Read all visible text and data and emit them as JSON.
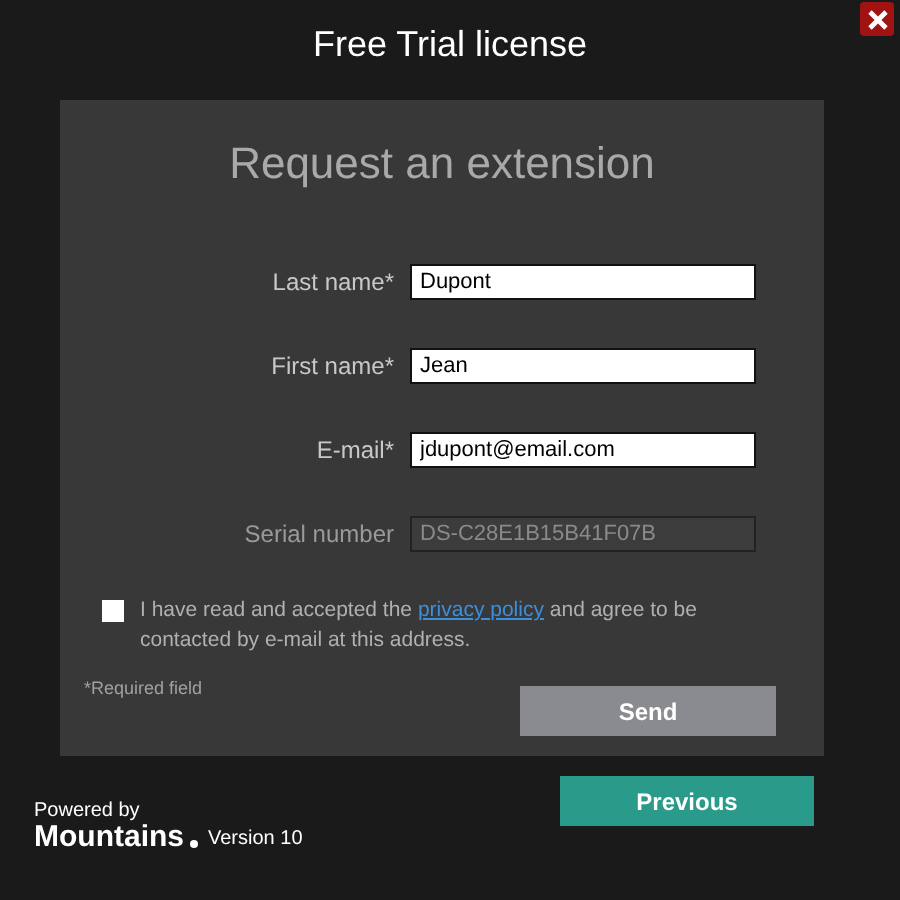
{
  "window": {
    "title": "Free Trial license"
  },
  "form": {
    "heading": "Request an extension",
    "fields": [
      {
        "label": "Last name*",
        "value": "Dupont",
        "disabled": false
      },
      {
        "label": "First name*",
        "value": "Jean",
        "disabled": false
      },
      {
        "label": "E-mail*",
        "value": "jdupont@email.com",
        "disabled": false
      },
      {
        "label": "Serial number",
        "value": "DS-C28E1B15B41F07B",
        "disabled": true
      }
    ],
    "consent": {
      "checked": false,
      "text_before": "I have read and accepted the",
      "link": "privacy policy",
      "text_after": "and agree to be contacted by e-mail at this address."
    },
    "required_note": "*Required field",
    "send_button": {
      "label": "Send",
      "disabled": true
    }
  },
  "footer": {
    "powered_by": "Powered by",
    "brand": "Mountains",
    "version": "Version 10",
    "previous_button": "Previous"
  }
}
